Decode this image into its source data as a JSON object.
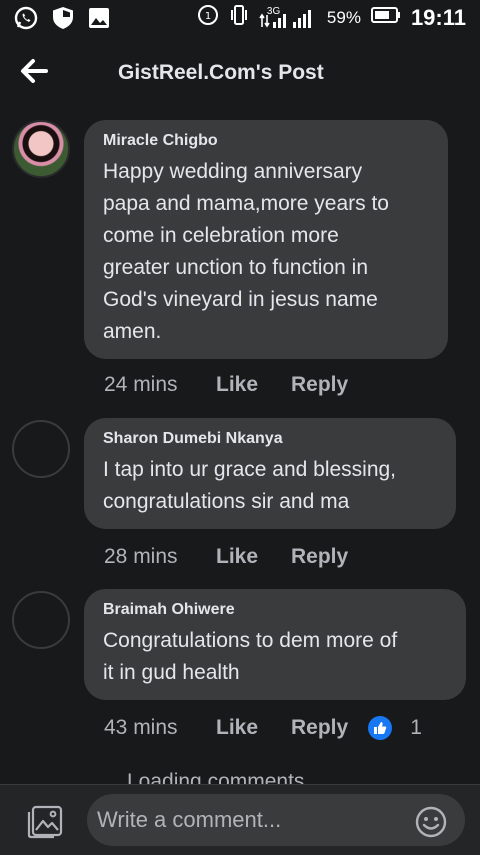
{
  "status_bar": {
    "battery_percent": "59%",
    "time": "19:11",
    "network": "3G",
    "notification_icons": [
      "whatsapp-icon",
      "shield-icon",
      "image-icon"
    ]
  },
  "header": {
    "title": "GistReel.Com's Post"
  },
  "comments": [
    {
      "author": "Miracle Chigbo",
      "text": "Happy wedding anniversary\npapa and mama,more years to\ncome in celebration more\ngreater unction to function in\nGod's vineyard in jesus name\namen.",
      "time": "24 mins",
      "like_label": "Like",
      "reply_label": "Reply"
    },
    {
      "author": "Sharon Dumebi Nkanya",
      "text": "I tap into ur grace and blessing,\ncongratulations sir and ma",
      "time": "28 mins",
      "like_label": "Like",
      "reply_label": "Reply"
    },
    {
      "author": "Braimah Ohiwere",
      "text": "Congratulations to dem more of\nit in gud health",
      "time": "43 mins",
      "like_label": "Like",
      "reply_label": "Reply",
      "reaction_count": "1"
    }
  ],
  "loading_text": "Loading comments...",
  "composer": {
    "placeholder": "Write a comment..."
  },
  "colors": {
    "background": "#18191a",
    "bubble": "#3a3b3c",
    "accent": "#1877f2"
  }
}
